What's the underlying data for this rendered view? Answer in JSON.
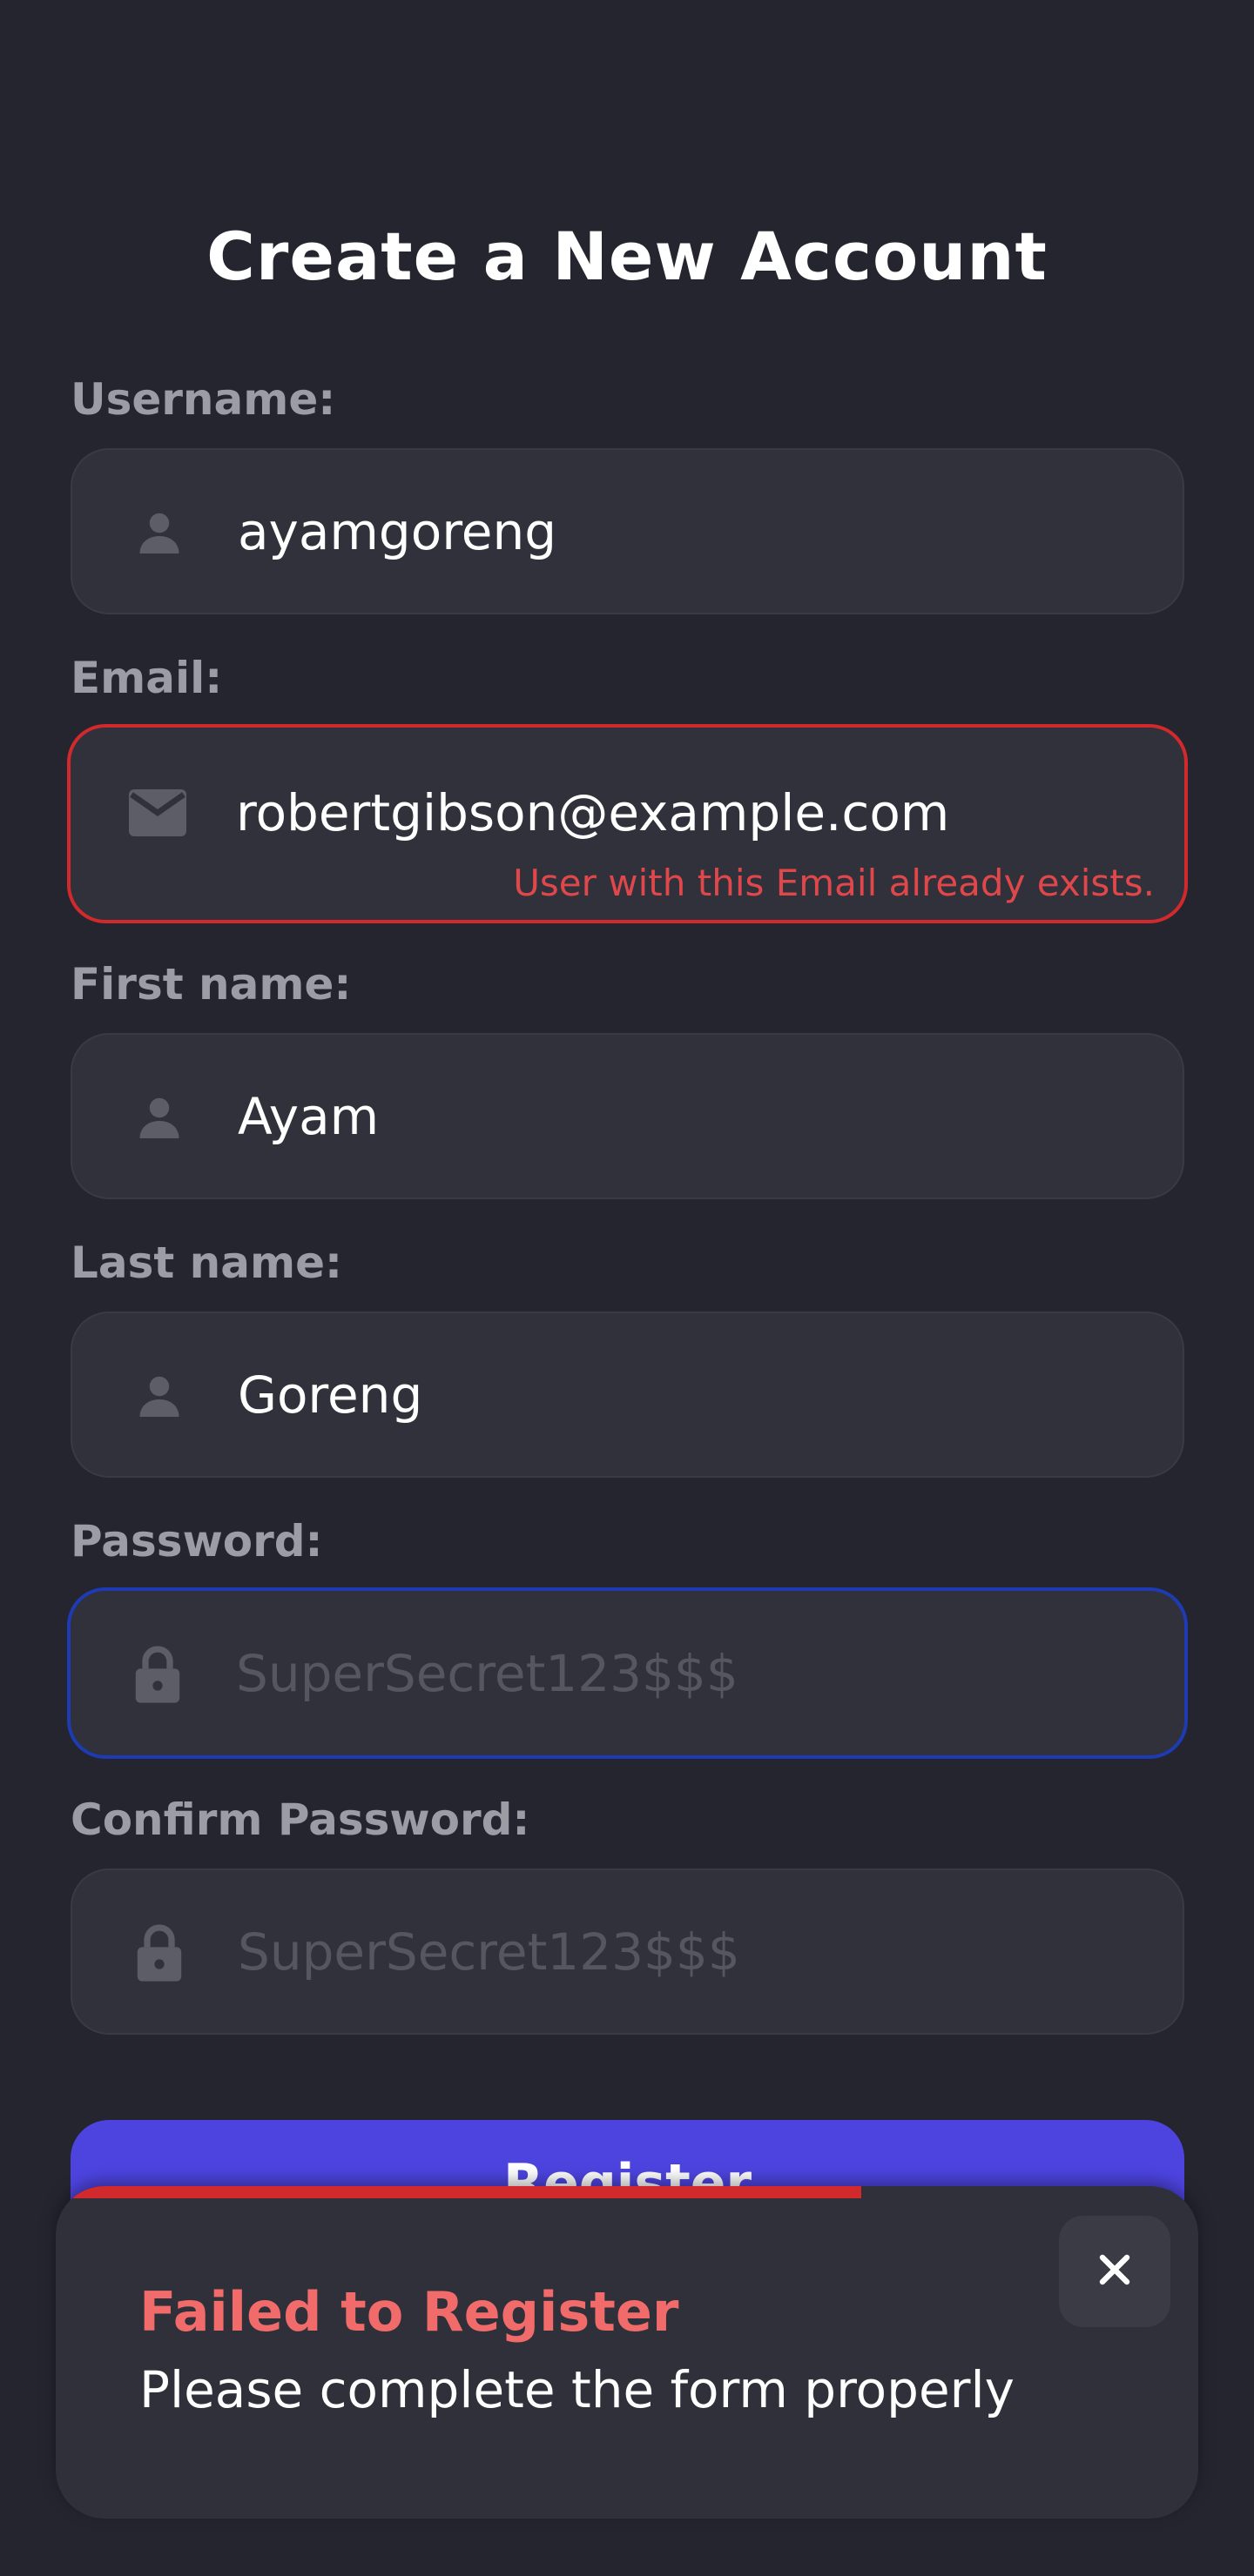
{
  "page": {
    "title": "Create a New Account"
  },
  "form": {
    "username": {
      "label": "Username:",
      "value": "ayamgoreng",
      "icon": "person-icon"
    },
    "email": {
      "label": "Email:",
      "value": "robertgibson@example.com",
      "icon": "mail-icon",
      "error": "User with this Email already exists."
    },
    "first_name": {
      "label": "First name:",
      "value": "Ayam",
      "icon": "person-icon"
    },
    "last_name": {
      "label": "Last name:",
      "value": "Goreng",
      "icon": "person-icon"
    },
    "password": {
      "label": "Password:",
      "value": "",
      "placeholder": "SuperSecret123$$$",
      "icon": "lock-icon"
    },
    "confirm_password": {
      "label": "Confirm Password:",
      "value": "",
      "placeholder": "SuperSecret123$$$",
      "icon": "lock-icon"
    },
    "register_label": "Register"
  },
  "toast": {
    "title": "Failed to Register",
    "message": "Please complete the form properly",
    "close_icon": "close-icon",
    "progress": 0.69
  },
  "colors": {
    "background": "#24252f",
    "field": "#30313b",
    "error": "#d1292c",
    "focus": "#1e3bb4",
    "accent": "#4d44e0",
    "toast_title": "#f26b6b"
  }
}
